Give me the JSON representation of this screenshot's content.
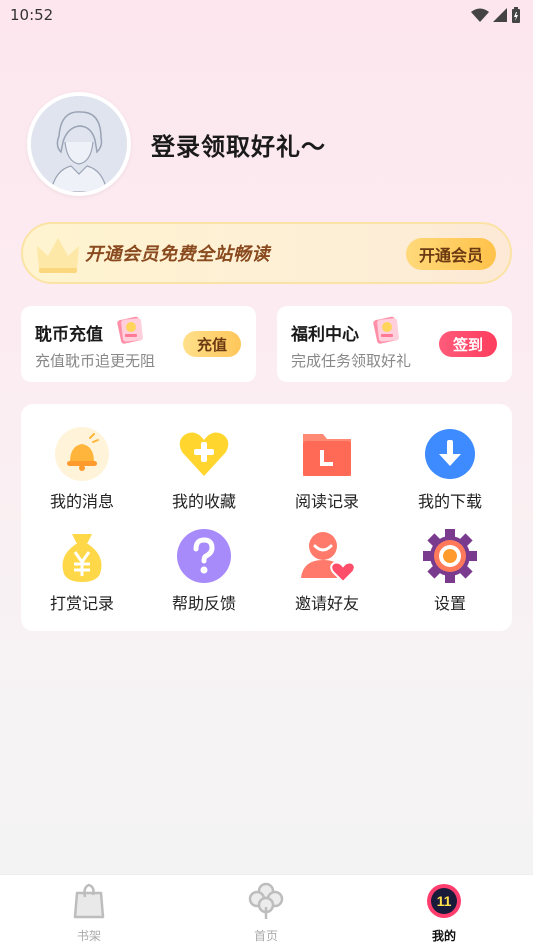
{
  "status_bar": {
    "time": "10:52"
  },
  "profile": {
    "login_text": "登录领取好礼～"
  },
  "vip_banner": {
    "text": "开通会员免费全站畅读",
    "button": "开通会员"
  },
  "cards": [
    {
      "title": "耽币充值",
      "subtitle": "充值耽币追更无阻",
      "button": "充值"
    },
    {
      "title": "福利中心",
      "subtitle": "完成任务领取好礼",
      "button": "签到"
    }
  ],
  "menu": [
    {
      "label": "我的消息",
      "icon": "bell-icon"
    },
    {
      "label": "我的收藏",
      "icon": "heart-plus-icon"
    },
    {
      "label": "阅读记录",
      "icon": "folder-history-icon"
    },
    {
      "label": "我的下载",
      "icon": "download-icon"
    },
    {
      "label": "打赏记录",
      "icon": "money-bag-icon"
    },
    {
      "label": "帮助反馈",
      "icon": "question-icon"
    },
    {
      "label": "邀请好友",
      "icon": "invite-friend-icon"
    },
    {
      "label": "设置",
      "icon": "settings-gear-icon"
    }
  ],
  "tabs": [
    {
      "label": "书架",
      "icon": "bookshelf-icon"
    },
    {
      "label": "首页",
      "icon": "home-flower-icon"
    },
    {
      "label": "我的",
      "icon": "mine-icon",
      "badge": "11"
    }
  ],
  "colors": {
    "accent_red": "#ff3d5e",
    "gold": "#ffc24a",
    "vip_text": "#8a4a1f"
  }
}
